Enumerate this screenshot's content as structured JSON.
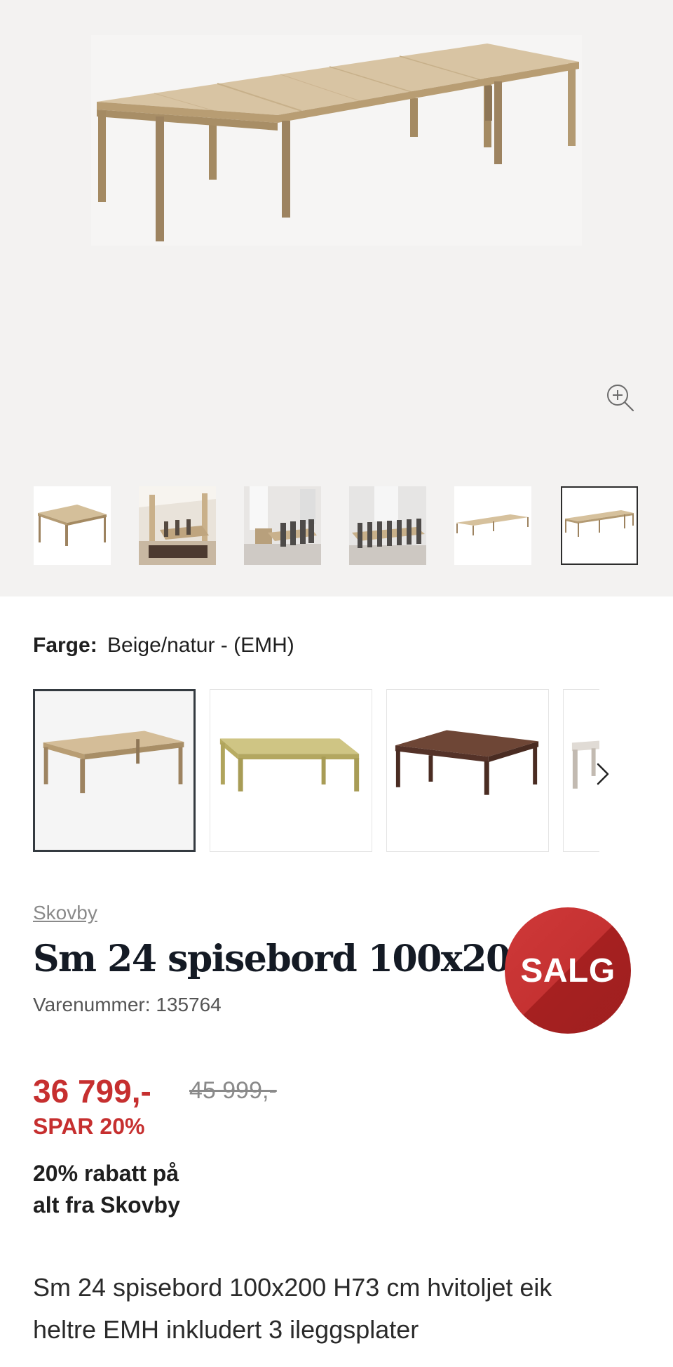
{
  "gallery": {
    "main_image_icon": "extended-table-image",
    "zoom_icon": "zoom-in-icon",
    "thumbnails": [
      {
        "icon": "table-thumbnail",
        "active": false
      },
      {
        "icon": "dining-room-thumbnail",
        "active": false
      },
      {
        "icon": "dining-room-chairs-thumbnail",
        "active": false
      },
      {
        "icon": "long-table-chairs-thumbnail",
        "active": false
      },
      {
        "icon": "extended-table-thumbnail",
        "active": false
      },
      {
        "icon": "extended-table-thumbnail",
        "active": true
      }
    ]
  },
  "color": {
    "label": "Farge:",
    "value": "Beige/natur - (EMH)",
    "swatches": [
      {
        "name": "Beige/natur",
        "color": "#d2b894",
        "selected": true
      },
      {
        "name": "Olive",
        "color": "#c8be78",
        "selected": false
      },
      {
        "name": "Walnut",
        "color": "#6b4535",
        "selected": false
      },
      {
        "name": "Light grey",
        "color": "#d9d4ce",
        "selected": false
      }
    ],
    "next_icon": "chevron-right-icon"
  },
  "product": {
    "brand": "Skovby",
    "title": "Sm 24 spisebord 100x200",
    "sku": "Varenummer: 135764",
    "badge": "SALG",
    "price": "36 799,-",
    "old_price": "45 999,-",
    "save": "SPAR 20%",
    "promo_line1": "20% rabatt på",
    "promo_line2": "alt fra Skovby",
    "description": "Sm 24 spisebord 100x200 H73 cm hvitoljet eik heltre EMH inkludert 3 ileggsplater"
  },
  "colors": {
    "accent_red": "#c62f2f",
    "badge_red": "#b82a2a",
    "gallery_bg": "#f3f2f1",
    "dark_text": "#141a24"
  }
}
